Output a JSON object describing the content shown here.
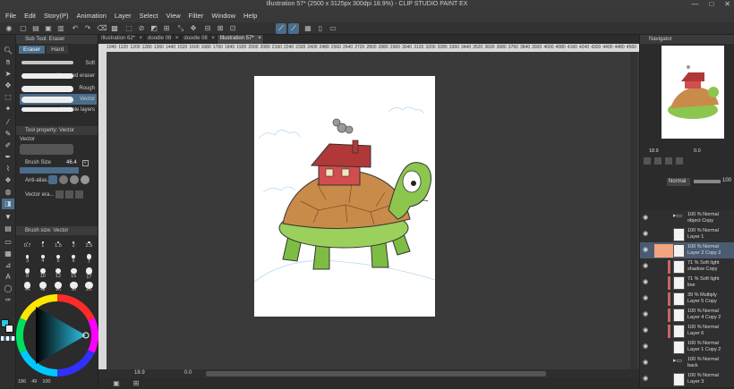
{
  "window": {
    "title": "Illustration 57* (2500 x 3125px 300dpi 18.9%) - CLIP STUDIO PAINT EX",
    "controls": [
      "—",
      "□",
      "✕"
    ]
  },
  "menu": [
    "File",
    "Edit",
    "Story(P)",
    "Animation",
    "Layer",
    "Select",
    "View",
    "Filter",
    "Window",
    "Help"
  ],
  "doc_tabs": [
    {
      "label": "Illustration 62*",
      "active": false
    },
    {
      "label": "doodle 08",
      "active": false
    },
    {
      "label": "doodle 08",
      "active": false
    },
    {
      "label": "Illustration 57*",
      "active": true
    }
  ],
  "ruler_ticks": [
    "1040",
    "1120",
    "1200",
    "1280",
    "1360",
    "1440",
    "1520",
    "1600",
    "1680",
    "1760",
    "1840",
    "1920",
    "2000",
    "2080",
    "2160",
    "2240",
    "2320",
    "2400",
    "2480",
    "2560",
    "2640",
    "2720",
    "2800",
    "2880",
    "2960",
    "3040",
    "3120",
    "3200",
    "3280",
    "3360",
    "3440",
    "3520",
    "3600",
    "3680",
    "3760",
    "3840",
    "3920",
    "4000",
    "4080",
    "4160",
    "4240",
    "4320",
    "4400",
    "4480",
    "4560"
  ],
  "subtool": {
    "title": "Sub Tool: Eraser",
    "tabs": [
      "Eraser",
      "Hard"
    ],
    "brushes": [
      "Soft",
      "Kneaded eraser",
      "Rough",
      "Vector",
      "Multiple layers"
    ],
    "selected": "Vector"
  },
  "tool_property": {
    "title": "Tool property: Vector",
    "preview_label": "Vector",
    "brush_size_label": "Brush Size",
    "brush_size_value": "46.4",
    "anti_alias_label": "Anti-alias...",
    "vector_eraser_label": "Vector era..."
  },
  "brush_size_panel": {
    "title": "Brush size: Vector",
    "sizes": [
      "0.7",
      "1",
      "1.5",
      "2",
      "2.5",
      "3",
      "4",
      "5",
      "6",
      "7",
      "8",
      "10",
      "12",
      "15",
      "17",
      "20",
      "25",
      "30",
      "40",
      "50"
    ]
  },
  "color": {
    "main": "#2ec4e6",
    "sub": "#f2f2f2",
    "values": [
      "186",
      "49",
      "100"
    ]
  },
  "status": {
    "zoom": "18.9",
    "angle": "0.0"
  },
  "navigator": {
    "title": "Navigator",
    "zoom": "18.9",
    "angle": "0.0"
  },
  "layer_panel": {
    "blend_mode": "Normal",
    "opacity": "100",
    "layers": [
      {
        "name": "100 % Normal\nobject Copy",
        "folder": true,
        "visible": true,
        "clip": false,
        "selected": false
      },
      {
        "name": "100 % Normal\nLayer 1",
        "folder": false,
        "visible": true,
        "clip": false,
        "selected": false
      },
      {
        "name": "100 % Normal\nLayer 2 Copy 2",
        "folder": false,
        "visible": true,
        "clip": false,
        "selected": true
      },
      {
        "name": "71 % Soft light\nshadow Copy",
        "folder": false,
        "visible": true,
        "clip": true,
        "selected": false
      },
      {
        "name": "71 % Soft light\nline",
        "folder": false,
        "visible": true,
        "clip": true,
        "selected": false
      },
      {
        "name": "39 % Multiply\nLayer 5 Copy",
        "folder": false,
        "visible": true,
        "clip": true,
        "selected": false
      },
      {
        "name": "100 % Normal\nLayer 4 Copy 2",
        "folder": false,
        "visible": true,
        "clip": true,
        "selected": false
      },
      {
        "name": "100 % Normal\nLayer 6",
        "folder": false,
        "visible": true,
        "clip": true,
        "selected": false
      },
      {
        "name": "100 % Normal\nLayer 1 Copy 2",
        "folder": false,
        "visible": true,
        "clip": false,
        "selected": false
      },
      {
        "name": "100 % Normal\nback",
        "folder": true,
        "visible": true,
        "clip": false,
        "selected": false
      },
      {
        "name": "100 % Normal\nLayer 3",
        "folder": false,
        "visible": true,
        "clip": false,
        "selected": false
      }
    ]
  }
}
